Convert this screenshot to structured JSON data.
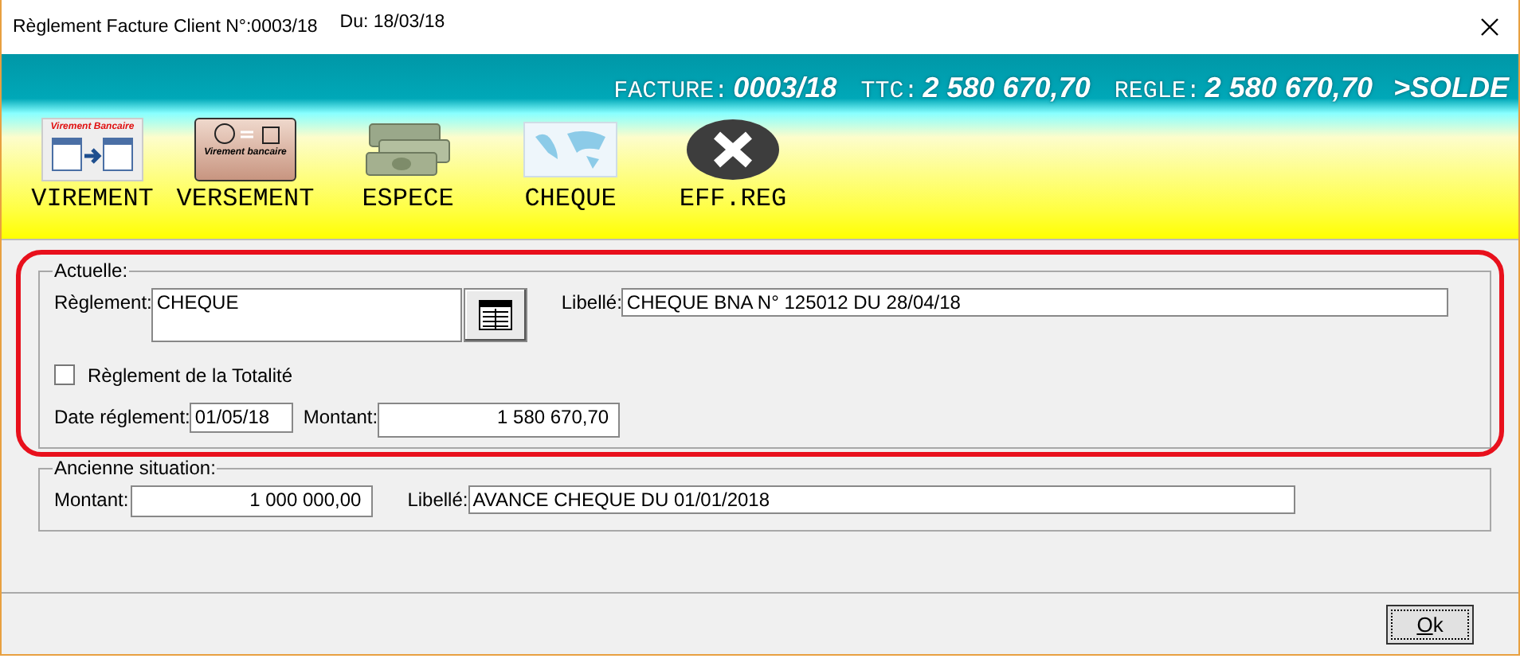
{
  "window": {
    "title": "Règlement Facture Client N°:0003/18",
    "date": "Du: 18/03/18"
  },
  "header": {
    "items": [
      {
        "label": "FACTURE:",
        "value": "0003/18"
      },
      {
        "label": "TTC:",
        "value": "2 580 670,70"
      },
      {
        "label": "REGLE:",
        "value": "2 580 670,70"
      }
    ],
    "status": ">SOLDE"
  },
  "toolbar": [
    {
      "kind": "virement",
      "label": "VIREMENT",
      "icon_text": "Virement Bancaire"
    },
    {
      "kind": "versement",
      "label": "VERSEMENT",
      "icon_text": "Virement bancaire"
    },
    {
      "kind": "espece",
      "label": "ESPECE"
    },
    {
      "kind": "cheque",
      "label": "CHEQUE"
    },
    {
      "kind": "delete",
      "label": "EFF.REG"
    }
  ],
  "actuelle": {
    "title": "Actuelle:",
    "reglement_label": "Règlement:",
    "reglement": "CHEQUE",
    "libelle_label": "Libellé:",
    "libelle": "CHEQUE BNA N° 125012 DU 28/04/18",
    "totalite": {
      "label": "Règlement de la Totalité",
      "checked": false
    },
    "date_label": "Date réglement:",
    "date": "01/05/18",
    "montant_label": "Montant:",
    "montant": "1 580 670,70",
    "highlighted": true
  },
  "ancienne": {
    "title": "Ancienne situation:",
    "montant_label": "Montant:",
    "montant": "1 000 000,00",
    "libelle_label": "Libellé:",
    "libelle": "AVANCE CHEQUE DU 01/01/2018"
  },
  "buttons": [
    {
      "label": "Ok"
    }
  ]
}
